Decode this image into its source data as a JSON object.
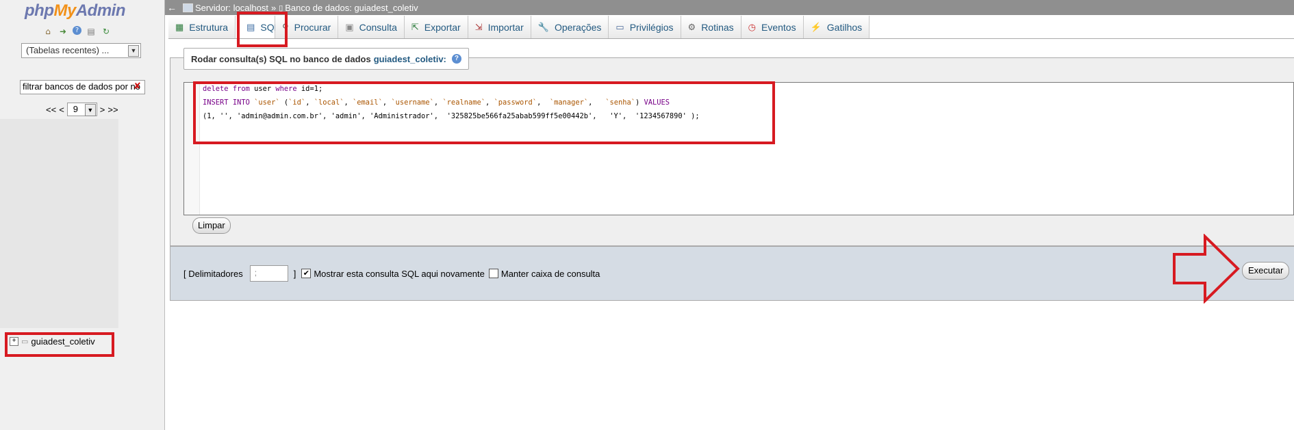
{
  "sidebar": {
    "logo": {
      "php": "php",
      "my": "My",
      "admin": "Admin"
    },
    "nav_icons": [
      "home-icon",
      "logout-icon",
      "help-icon",
      "docs-icon",
      "reload-icon"
    ],
    "recent_select": "(Tabelas recentes) ...",
    "filter_value": "filtrar bancos de dados por no",
    "pager": {
      "first": "<<",
      "prev": "<",
      "page": "9",
      "next": ">",
      "last": ">>"
    },
    "database": "guiadest_coletiv"
  },
  "breadcrumb": {
    "server_label": "Servidor: localhost",
    "sep": "»",
    "db_label": "Banco de dados: guiadest_coletiv"
  },
  "tabs": [
    {
      "label": "Estrutura",
      "icon": "structure-icon"
    },
    {
      "label": "SQL",
      "icon": "sql-icon",
      "active": true
    },
    {
      "label": "Procurar",
      "icon": "search-icon"
    },
    {
      "label": "Consulta",
      "icon": "query-icon"
    },
    {
      "label": "Exportar",
      "icon": "export-icon"
    },
    {
      "label": "Importar",
      "icon": "import-icon"
    },
    {
      "label": "Operações",
      "icon": "wrench-icon"
    },
    {
      "label": "Privilégios",
      "icon": "privileges-icon"
    },
    {
      "label": "Rotinas",
      "icon": "routines-icon"
    },
    {
      "label": "Eventos",
      "icon": "clock-icon"
    },
    {
      "label": "Gatilhos",
      "icon": "triggers-icon"
    }
  ],
  "query_panel": {
    "legend": "Rodar consulta(s) SQL no banco de dados",
    "legend_db": "guiadest_coletiv:",
    "code": {
      "line1": {
        "kw1": "delete",
        "kw2": "from",
        "t1": " user ",
        "kw3": "where",
        "t2": " id=1;"
      },
      "line2": {
        "kw1": "INSERT",
        "kw2": "INTO",
        "s1": "`user`",
        "t1": " (",
        "s2": "`id`",
        "s3": "`local`",
        "s4": "`email`",
        "s5": "`username`",
        "s6": "`realname`",
        "s7": "`password`",
        "s8": "`manager`",
        "s9": "`senha`",
        "t2": ") ",
        "kw3": "VALUES"
      },
      "line3": "(1, '', 'admin@admin.com.br', 'admin', 'Administrador',  '325825be566fa25abab599ff5e00442b',   'Y',  '1234567890' );"
    },
    "clear_label": "Limpar"
  },
  "footer": {
    "delimiters_label": "[ Delimitadores",
    "delimiter_value": ";",
    "close_bracket": "]",
    "show_again_label": "Mostrar esta consulta SQL aqui novamente",
    "show_again_checked": true,
    "keep_box_label": "Manter caixa de consulta",
    "keep_box_checked": false,
    "execute_label": "Executar"
  },
  "colors": {
    "highlight": "#d71a21",
    "link": "#235a81",
    "logo_blue": "#6c78af",
    "logo_orange": "#f29119"
  }
}
